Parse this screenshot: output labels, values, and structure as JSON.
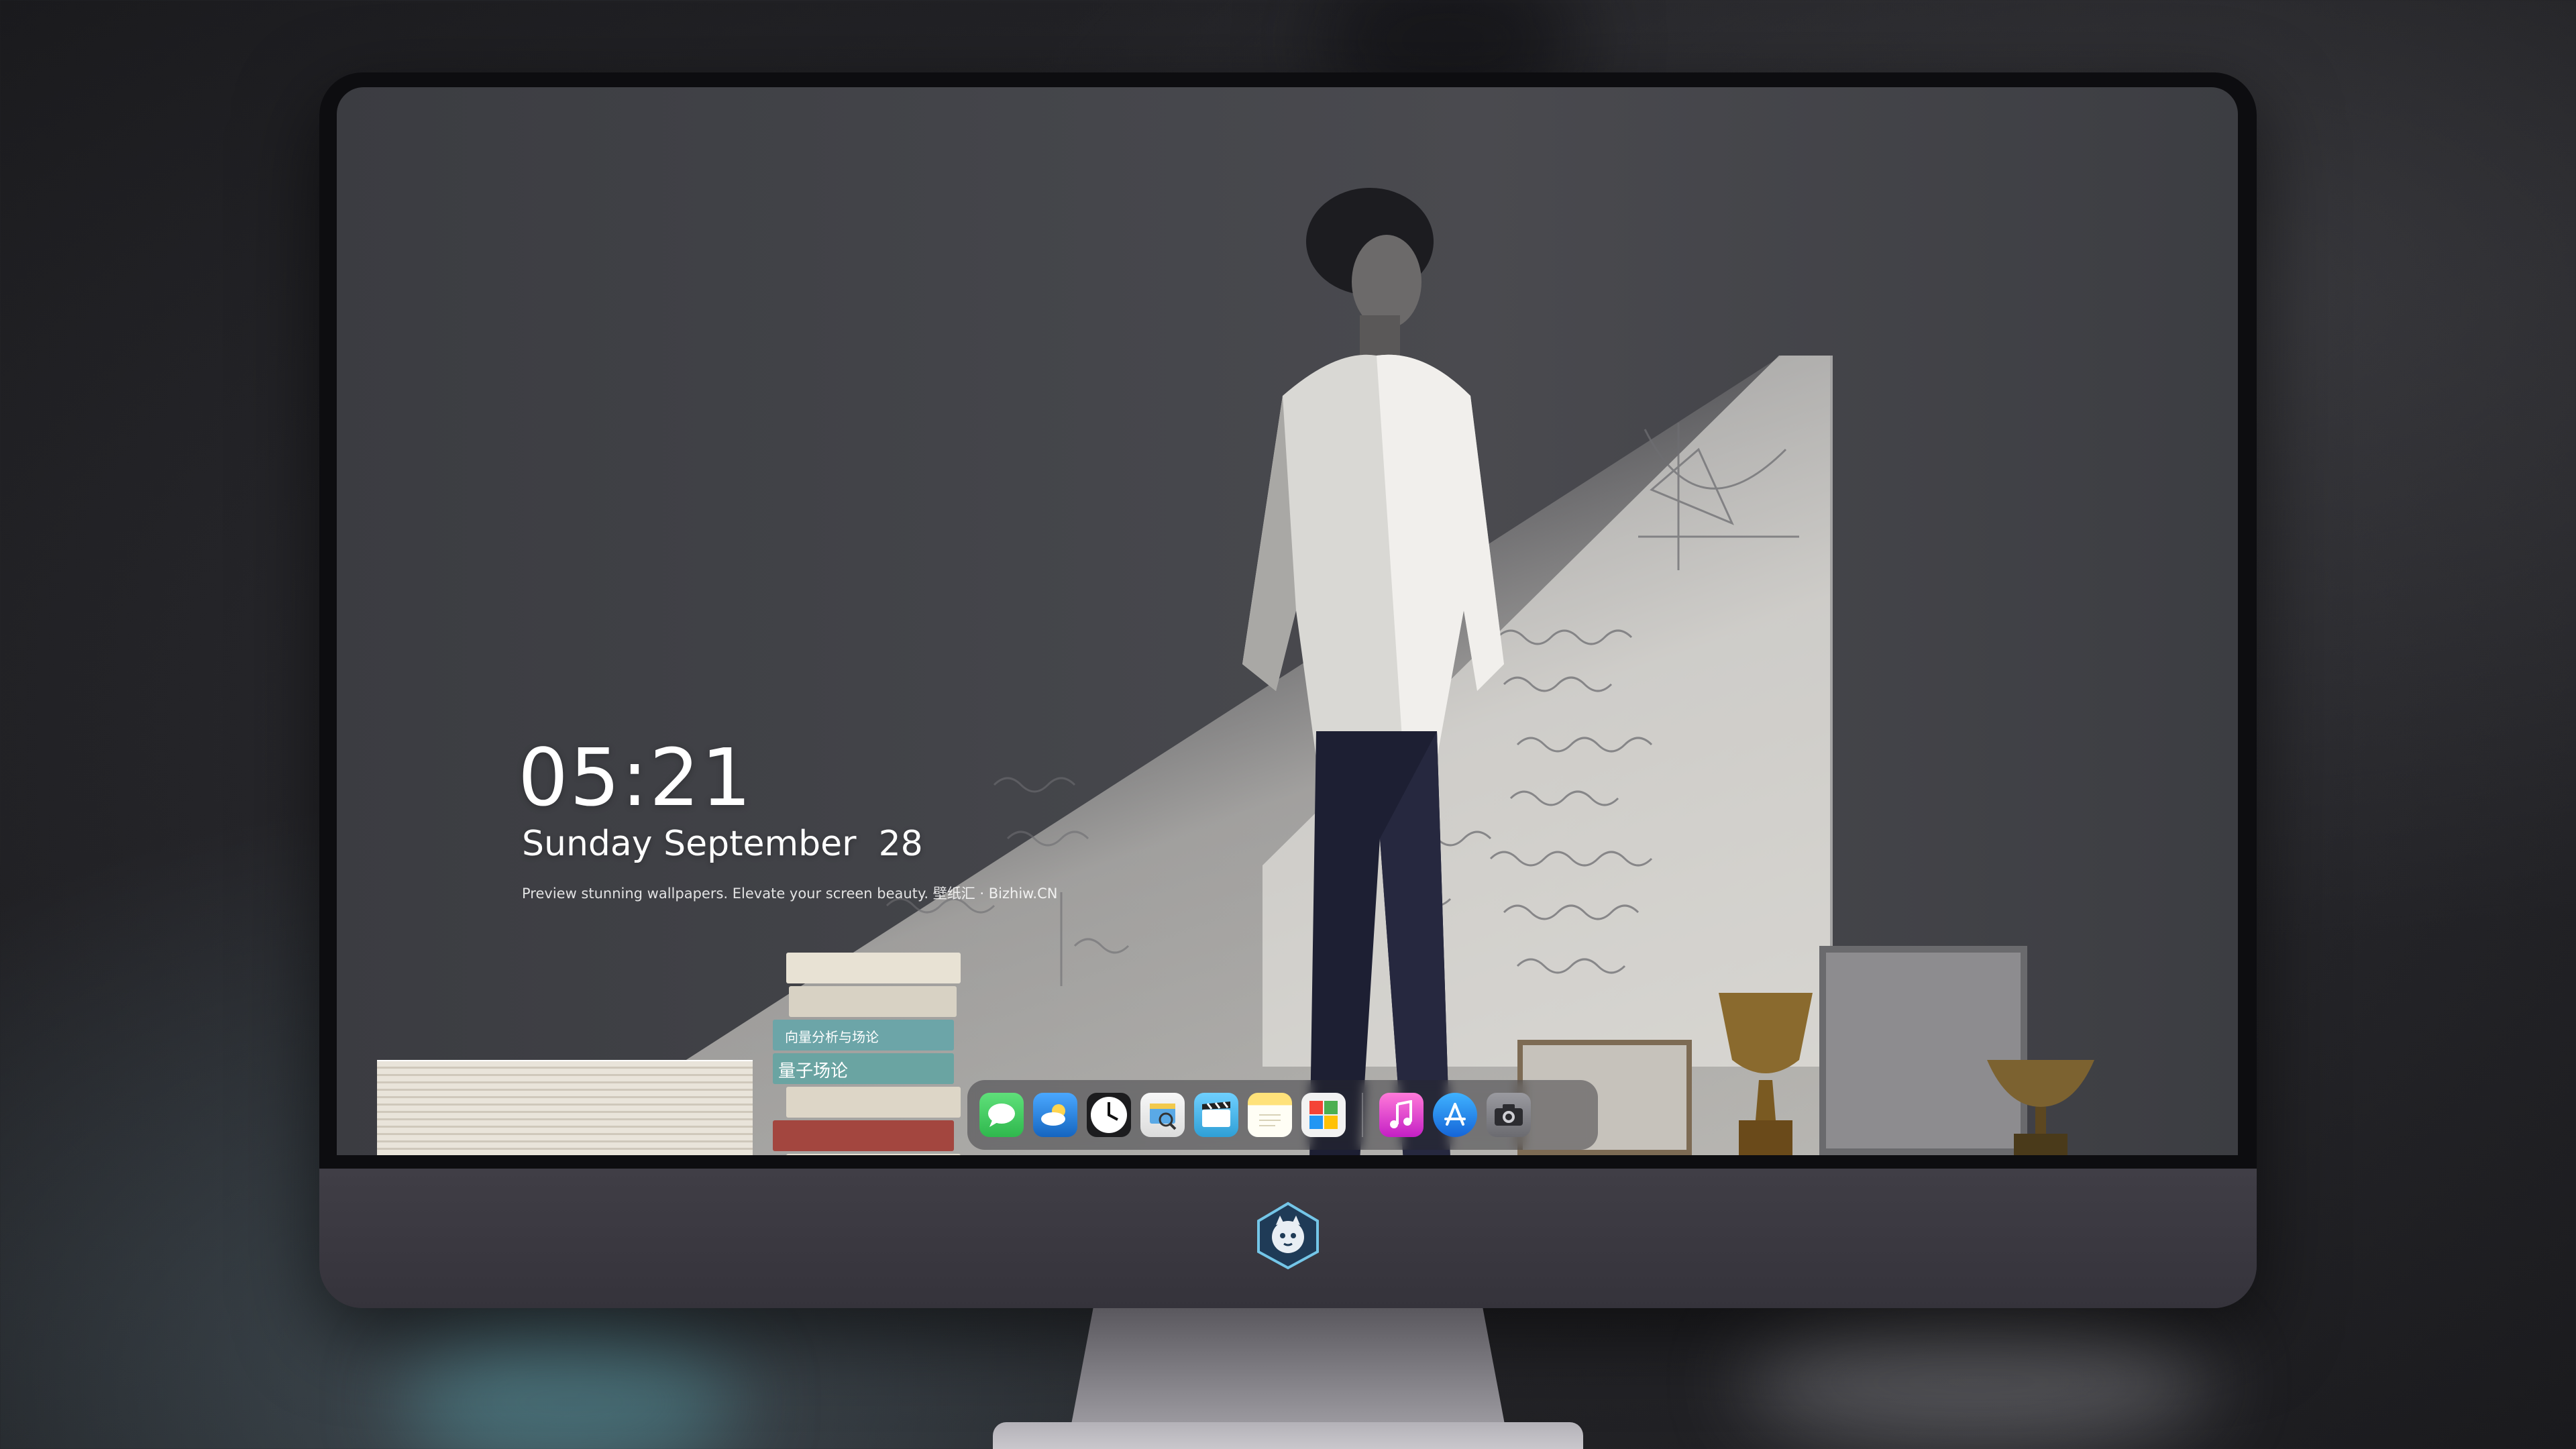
{
  "lockscreen": {
    "time": "05:21",
    "date": "Sunday September  28",
    "tagline": "Preview stunning wallpapers. Elevate your screen beauty. 壁纸汇 · Bizhiw.CN"
  },
  "dock": {
    "apps": [
      {
        "icon": "messages-icon",
        "color": "#34c759"
      },
      {
        "icon": "weather-icon",
        "color": "#1e88e5"
      },
      {
        "icon": "clock-icon",
        "color": "#1c1c1e"
      },
      {
        "icon": "preview-icon",
        "color": "#f2c94c"
      },
      {
        "icon": "clips-icon",
        "color": "#4fc3f7"
      },
      {
        "icon": "notes-icon",
        "color": "#ffd54f"
      },
      {
        "icon": "photo-booth-icon",
        "color": "#ffffff"
      },
      {
        "icon": "music-icon",
        "color": "#ff4fc6"
      },
      {
        "icon": "app-store-icon",
        "color": "#1e88e5"
      },
      {
        "icon": "camera-icon",
        "color": "#8e8e93"
      }
    ]
  },
  "wallpaper": {
    "book_spines": [
      "向量分析与场论",
      "量子场论"
    ]
  },
  "colors": {
    "bezel": "#0d0d10",
    "chin": "#3a3840"
  }
}
